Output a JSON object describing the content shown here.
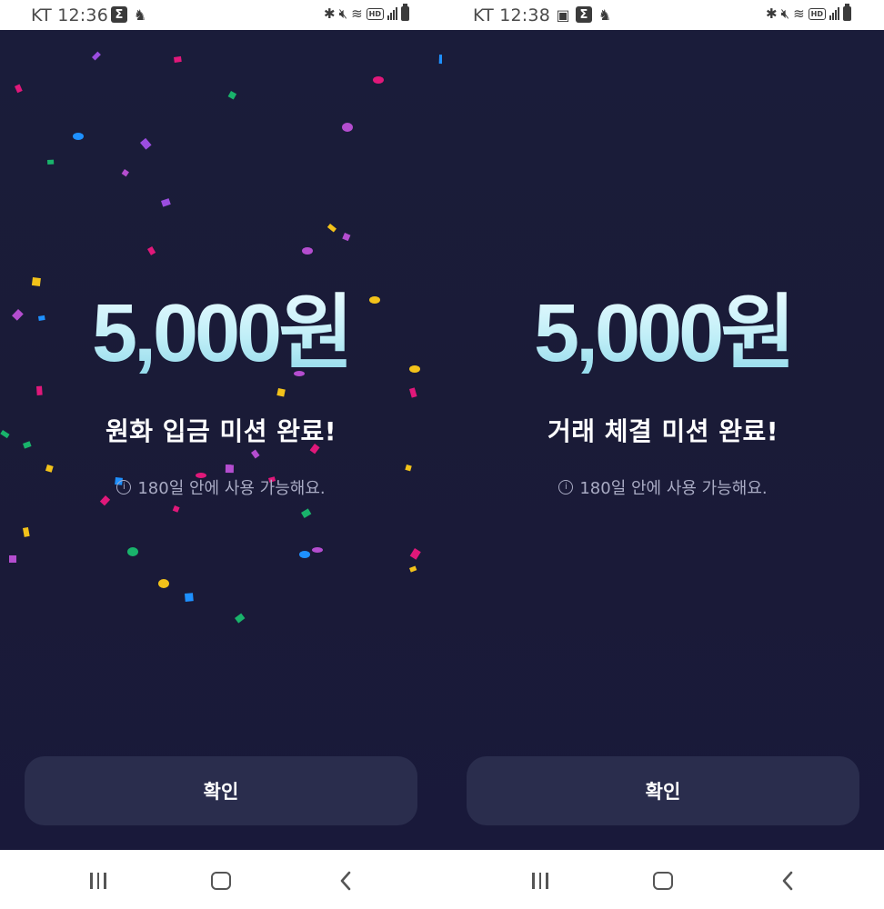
{
  "screens": [
    {
      "status_time": "KT 12:36",
      "amount": "5,000원",
      "mission": "원화 입금 미션 완료!",
      "note": "180일 안에 사용 가능해요.",
      "confirm_label": "확인",
      "has_confetti": true
    },
    {
      "status_time": "KT 12:38",
      "amount": "5,000원",
      "mission": "거래 체결 미션 완료!",
      "note": "180일 안에 사용 가능해요.",
      "confirm_label": "확인",
      "has_confetti": false
    }
  ],
  "status_icons": {
    "left": [
      "sigma-icon",
      "fox-notification-icon"
    ],
    "left_extra_second_screen": [
      "image-icon"
    ],
    "right": [
      "bluetooth-icon",
      "mute-icon",
      "wifi-icon",
      "hd-badge-icon",
      "signal-icon",
      "battery-icon"
    ],
    "hd_label": "HD"
  },
  "info_glyph": "i",
  "colors": {
    "background": "#1a1c3a",
    "button": "#2a2d4d",
    "amount_gradient": [
      "#e9fbff",
      "#8fd8ea"
    ],
    "note": "#a9abc4",
    "confetti": [
      "#9b4de0",
      "#e0187a",
      "#1e90ff",
      "#f2c21a",
      "#19b36b",
      "#b44dcf"
    ]
  }
}
